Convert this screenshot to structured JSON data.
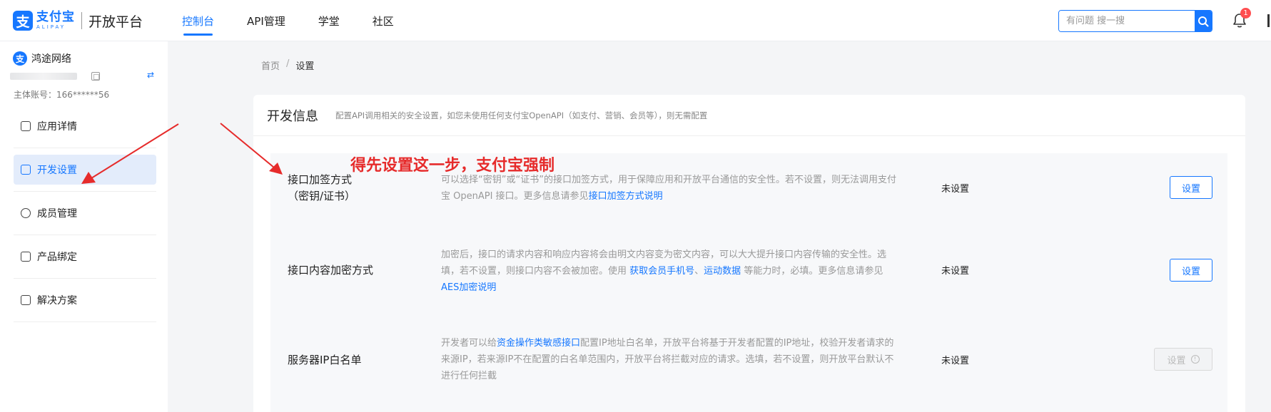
{
  "topbar": {
    "logo_cn": "支付宝",
    "logo_en": "ALIPAY",
    "logo_mark": "支",
    "platform": "开放平台",
    "nav": [
      {
        "label": "控制台",
        "active": true
      },
      {
        "label": "API管理",
        "active": false
      },
      {
        "label": "学堂",
        "active": false
      },
      {
        "label": "社区",
        "active": false
      }
    ],
    "search_placeholder": "有问题 搜一搜",
    "notification_count": "1"
  },
  "sidebar": {
    "org_icon": "支",
    "org_name": "鸿途网络",
    "account_label": "主体账号：166******56",
    "switch_glyph": "⇄",
    "menu": [
      {
        "label": "应用详情",
        "icon": "app-detail-icon",
        "active": false
      },
      {
        "label": "开发设置",
        "active": true,
        "icon": "dev-settings-icon"
      },
      {
        "label": "成员管理",
        "icon": "members-icon",
        "active": false
      },
      {
        "label": "产品绑定",
        "icon": "product-bind-icon",
        "active": false
      },
      {
        "label": "解决方案",
        "icon": "solution-icon",
        "active": false
      }
    ]
  },
  "breadcrumb": {
    "home": "首页",
    "sep": "/",
    "current": "设置"
  },
  "card": {
    "title": "开发信息",
    "description": "配置API调用相关的安全设置，如您未使用任何支付宝OpenAPI（如支付、营销、会员等），则无需配置",
    "rows": [
      {
        "name_line1": "接口加签方式",
        "name_line2": "（密钥/证书）",
        "desc_pre": "可以选择“密钥”或“证书”的接口加签方式，用于保障应用和开放平台通信的安全性。若不设置，则无法调用支付宝 OpenAPI 接口。更多信息请参见",
        "desc_link": "接口加签方式说明",
        "status": "未设置",
        "button": "设置"
      },
      {
        "name_line1": "接口内容加密方式",
        "desc_pre": "加密后，接口的请求内容和响应内容将会由明文内容变为密文内容，可以大大提升接口内容传输的安全性。选填，若不设置，则接口内容不会被加密。使用 ",
        "desc_link1": "获取会员手机号",
        "desc_mid": "、",
        "desc_link2": "运动数据",
        "desc_post": " 等能力时，必填。更多信息请参见",
        "desc_link3": "AES加密说明",
        "status": "未设置",
        "button": "设置"
      },
      {
        "name_line1": "服务器IP白名单",
        "desc_pre": "开发者可以给",
        "desc_link": "资金操作类敏感接口",
        "desc_post": "配置IP地址白名单，开放平台将基于开发者配置的IP地址，校验开发者请求的来源IP，若来源IP不在配置的白名单范围内，开放平台将拦截对应的请求。选填，若不设置，则开放平台默认不进行任何拦截",
        "status": "未设置",
        "button": "设置",
        "info_glyph": "!"
      }
    ]
  },
  "annotation": "得先设置这一步，支付宝强制",
  "colors": {
    "accent": "#1677ff",
    "annotation": "#e62b2b"
  }
}
